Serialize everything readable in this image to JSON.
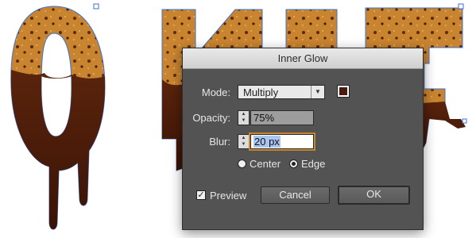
{
  "dialog": {
    "title": "Inner Glow",
    "mode_label": "Mode:",
    "mode_value": "Multiply",
    "opacity_label": "Opacity:",
    "opacity_value": "75%",
    "blur_label": "Blur:",
    "blur_value": "20 px",
    "center_label": "Center",
    "edge_label": "Edge",
    "selected_source": "Edge",
    "preview_label": "Preview",
    "preview_checked": true,
    "cancel_label": "Cancel",
    "ok_label": "OK",
    "glow_color": "#4a1a0f"
  },
  "colors": {
    "cookie": "#c9842f",
    "chocolate": "#4a1e0c",
    "path_stroke": "#3a73d6"
  }
}
